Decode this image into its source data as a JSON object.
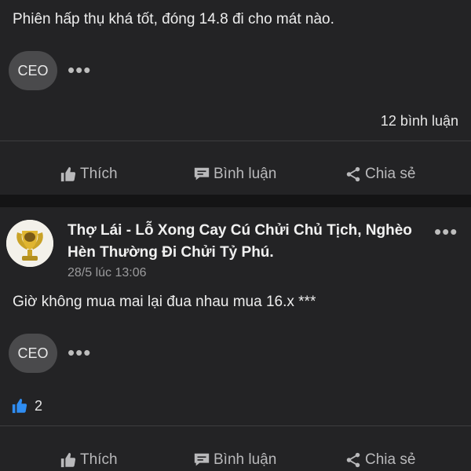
{
  "post1": {
    "text": "Phiên hấp thụ khá tốt, đóng 14.8 đi cho mát nào.",
    "tag": "CEO",
    "more": "•••",
    "comment_count": "12 bình luận"
  },
  "actions": {
    "like": "Thích",
    "comment": "Bình luận",
    "share": "Chia sẻ"
  },
  "post2": {
    "author": "Thợ Lái - Lỗ Xong Cay Cú Chửi Chủ Tịch, Nghèo Hèn Thường Đi Chửi Tỷ Phú.",
    "timestamp": "28/5 lúc 13:06",
    "more": "•••",
    "text": "Giờ không mua mai lại đua nhau mua 16.x ***",
    "tag": "CEO",
    "tag_more": "•••",
    "likes": "2"
  },
  "colors": {
    "background": "#232325",
    "separator": "#141415",
    "like_blue": "#2f8df2",
    "action_gray": "#b9b9bb"
  },
  "icons": {
    "like": "thumbs-up-icon",
    "comment": "chat-bubble-icon",
    "share": "share-icon",
    "avatar": "trophy-avatar"
  }
}
